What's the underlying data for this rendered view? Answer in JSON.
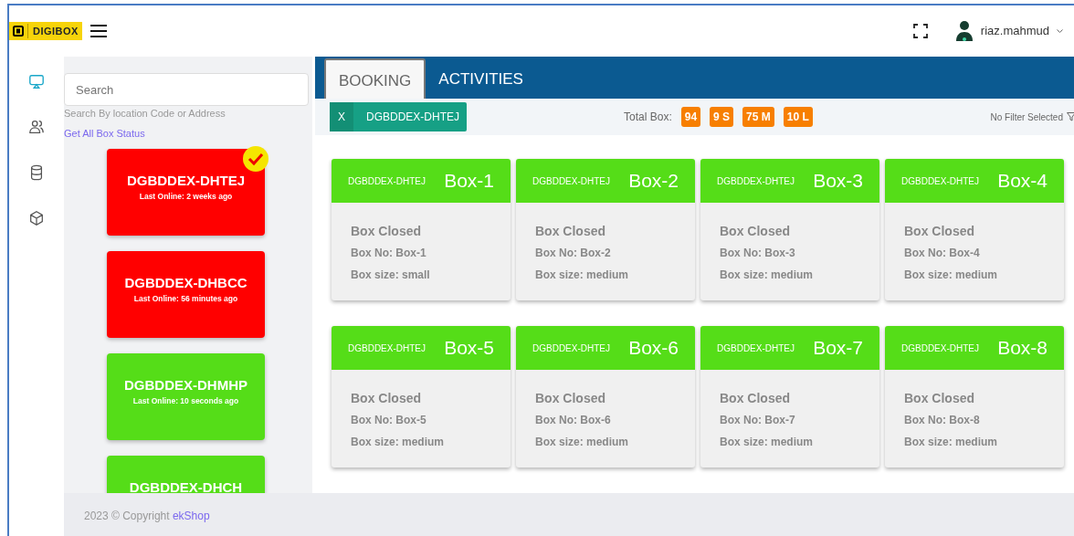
{
  "brand": {
    "name": "DIGIBOX"
  },
  "user": {
    "name": "riaz.mahmud"
  },
  "rail": [
    {
      "kind": "monitor",
      "selected": true
    },
    {
      "kind": "users",
      "selected": false
    },
    {
      "kind": "database",
      "selected": false
    },
    {
      "kind": "cube",
      "selected": false
    }
  ],
  "search": {
    "placeholder": "Search",
    "hint": "Search By location Code or Address",
    "link": "Get All Box Status"
  },
  "locations": [
    {
      "code": "DGBDDEX-DHTEJ",
      "last_online": "Last Online: 2 weeks ago",
      "color": "#ff0000",
      "selected": true
    },
    {
      "code": "DGBDDEX-DHBCC",
      "last_online": "Last Online: 56 minutes ago",
      "color": "#ff0000",
      "selected": false
    },
    {
      "code": "DGBDDEX-DHMHP",
      "last_online": "Last Online: 10 seconds ago",
      "color": "#55dd18",
      "selected": false
    },
    {
      "code": "DGBDDEX-DHCH",
      "color": "#55dd18",
      "selected": false
    }
  ],
  "tabs": [
    {
      "label": "BOOKING",
      "selected": true
    },
    {
      "label": "ACTIVITIES",
      "selected": false
    }
  ],
  "filter_chip": {
    "close": "X",
    "label": "DGBDDEX-DHTEJ"
  },
  "totals": {
    "label": "Total Box:",
    "counts": [
      "94",
      "9 S",
      "75 M",
      "10 L"
    ]
  },
  "filter_status": "No Filter Selected",
  "boxes": [
    {
      "location": "DGBDDEX-DHTEJ",
      "name": "Box-1",
      "status": "Box Closed",
      "number": "Box No: Box-1",
      "size": "Box size: small"
    },
    {
      "location": "DGBDDEX-DHTEJ",
      "name": "Box-2",
      "status": "Box Closed",
      "number": "Box No: Box-2",
      "size": "Box size: medium"
    },
    {
      "location": "DGBDDEX-DHTEJ",
      "name": "Box-3",
      "status": "Box Closed",
      "number": "Box No: Box-3",
      "size": "Box size: medium"
    },
    {
      "location": "DGBDDEX-DHTEJ",
      "name": "Box-4",
      "status": "Box Closed",
      "number": "Box No: Box-4",
      "size": "Box size: medium"
    },
    {
      "location": "DGBDDEX-DHTEJ",
      "name": "Box-5",
      "status": "Box Closed",
      "number": "Box No: Box-5",
      "size": "Box size: medium"
    },
    {
      "location": "DGBDDEX-DHTEJ",
      "name": "Box-6",
      "status": "Box Closed",
      "number": "Box No: Box-6",
      "size": "Box size: medium"
    },
    {
      "location": "DGBDDEX-DHTEJ",
      "name": "Box-7",
      "status": "Box Closed",
      "number": "Box No: Box-7",
      "size": "Box size: medium"
    },
    {
      "location": "DGBDDEX-DHTEJ",
      "name": "Box-8",
      "status": "Box Closed",
      "number": "Box No: Box-8",
      "size": "Box size: medium"
    }
  ],
  "footer": {
    "text": "2023 © Copyright",
    "link": "ekShop"
  }
}
